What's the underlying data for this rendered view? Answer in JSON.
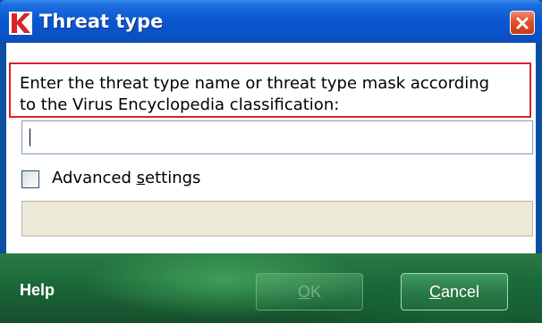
{
  "window": {
    "title": "Threat type"
  },
  "prompt": {
    "line1": "Enter the threat type name or threat type mask according",
    "line2": "to the Virus Encyclopedia classification:"
  },
  "input": {
    "value": ""
  },
  "advanced": {
    "checked": false,
    "label_before": "Advanced ",
    "label_accel": "s",
    "label_after": "ettings"
  },
  "footer": {
    "help": "Help",
    "ok_accel": "O",
    "ok_rest": "K",
    "cancel_accel": "C",
    "cancel_rest": "ancel"
  },
  "icons": {
    "app": "kaspersky-k-logo-icon",
    "close": "close-x-icon"
  },
  "colors": {
    "titlebar": "#0b58d0",
    "highlight_border": "#d8232a",
    "footer": "#1d6a3a"
  }
}
